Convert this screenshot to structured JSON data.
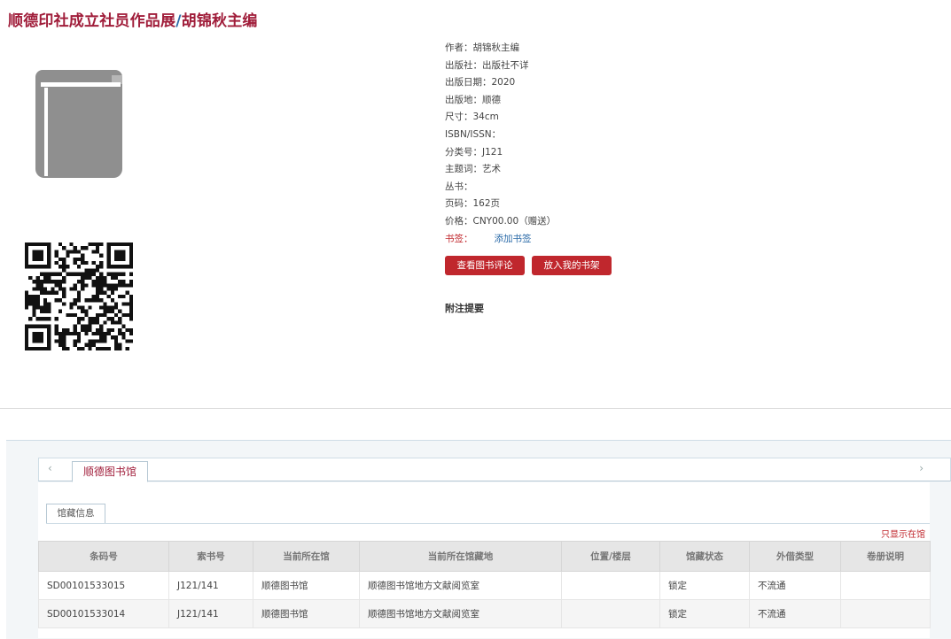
{
  "title": {
    "main": "顺德印社成立社员作品展",
    "separator": "/",
    "author": "胡锦秋主编"
  },
  "meta": {
    "author": "作者：胡锦秋主编",
    "publisher": "出版社：出版社不详",
    "pub_date": "出版日期：2020",
    "pub_place": "出版地：顺德",
    "size": "尺寸：34cm",
    "isbn": "ISBN/ISSN：",
    "class_no": "分类号：J121",
    "subject": "主题词：艺术",
    "series": "丛书：",
    "pages": "页码：162页",
    "price": "价格：CNY00.00（赠送）",
    "tag_label": "书签：",
    "tag_link": "添加书签"
  },
  "buttons": {
    "review": "查看图书评论",
    "shelf": "放入我的书架"
  },
  "annotation_label": "附注提要",
  "library_tabs": {
    "prev": "‹",
    "next": "›",
    "active": "顺德图书馆"
  },
  "holdings": {
    "subtab": "馆藏信息",
    "only_in_library": "只显示在馆",
    "headers": [
      "条码号",
      "索书号",
      "当前所在馆",
      "当前所在馆藏地",
      "位置/楼层",
      "馆藏状态",
      "外借类型",
      "卷册说明"
    ],
    "rows": [
      [
        "SD00101533015",
        "J121/141",
        "顺德图书馆",
        "顺德图书馆地方文献阅览室",
        "",
        "锁定",
        "不流通",
        ""
      ],
      [
        "SD00101533014",
        "J121/141",
        "顺德图书馆",
        "顺德图书馆地方文献阅览室",
        "",
        "锁定",
        "不流通",
        ""
      ]
    ]
  },
  "icons": {
    "cover": "book-icon",
    "qr": "qr-code-icon"
  },
  "colors": {
    "title": "#a01d3a",
    "button": "#c0272d",
    "link": "#2a6aa8"
  }
}
